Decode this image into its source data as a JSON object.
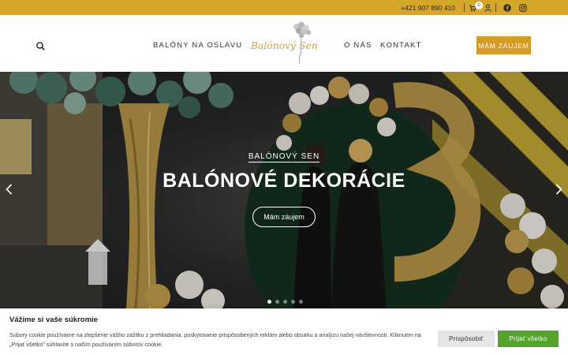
{
  "topbar": {
    "phone": "+421 907 890 410",
    "cart_count": "0",
    "icons": [
      "cart-icon",
      "user-icon",
      "facebook-icon",
      "instagram-icon"
    ]
  },
  "header": {
    "nav": {
      "balony": "BALÓNY NA OSLAVU",
      "onas": "O NÁS",
      "kontakt": "KONTAKT"
    },
    "logo_text": "Balónový Sen",
    "cta": "MÁM ZÁUJEM"
  },
  "hero": {
    "kicker": "BALÓNOVÝ SEN",
    "title": "BALÓNOVÉ DEKORÁCIE",
    "button": "Mám záujem",
    "slide_count": 5,
    "active_slide": 1
  },
  "cookie": {
    "title": "Vážime si vaše súkromie",
    "text": "Súbory cookie používame na zlepšenie vášho zážitku z prehliadania, poskytovanie prispôsobených reklám alebo obsahu a analýzu našej návštevnosti. Kliknutím na „Prijať všetko\" súhlasíte s naším používaním súborov cookie.",
    "customize": "Prispôsobiť",
    "accept": "Prijať všetko"
  },
  "colors": {
    "gold": "#d4a62a",
    "accent": "#d39b27",
    "accept_green": "#55a22d"
  }
}
